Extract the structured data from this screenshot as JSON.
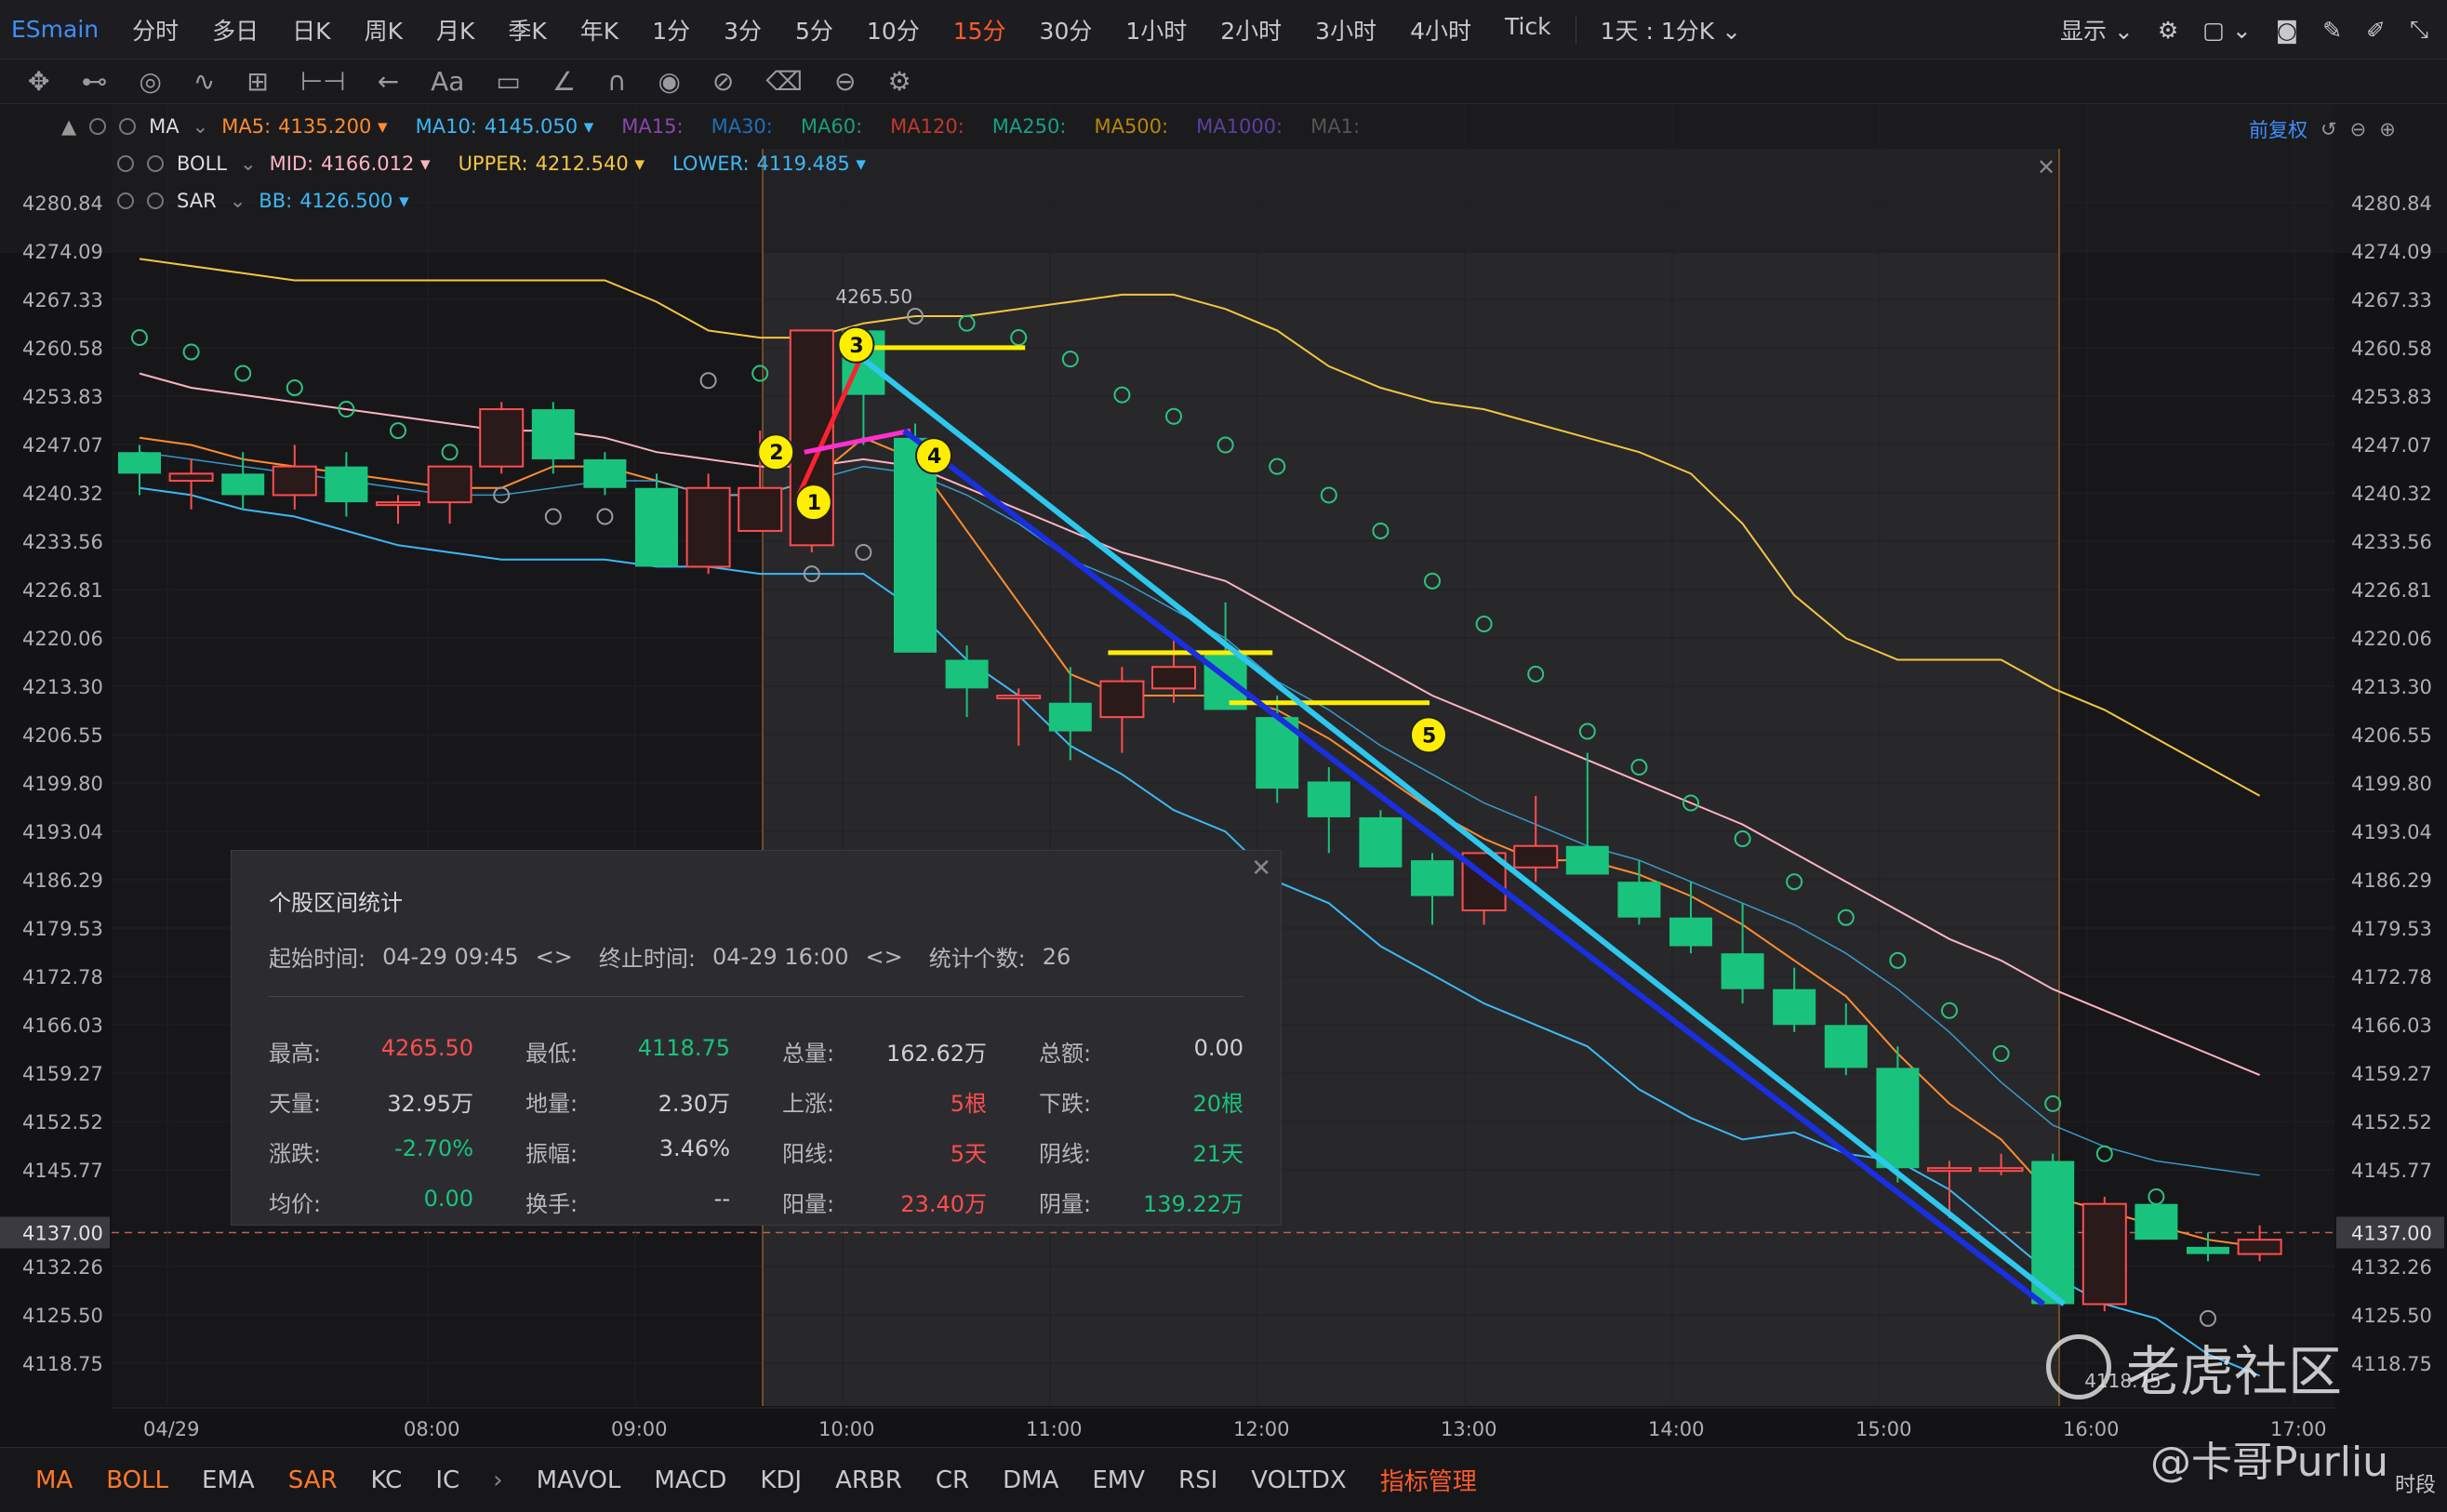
{
  "symbol": "ESmain",
  "periods": [
    "分时",
    "多日",
    "日K",
    "周K",
    "月K",
    "季K",
    "年K",
    "1分",
    "3分",
    "5分",
    "10分",
    "15分",
    "30分",
    "1小时",
    "2小时",
    "3小时",
    "4小时",
    "Tick"
  ],
  "active_period": "15分",
  "multi_chart": "1天 : 1分K",
  "display_label": "显示",
  "adjust_label": "前复权",
  "indicators": {
    "ma": {
      "name": "MA",
      "items": [
        {
          "label": "MA5:",
          "value": "4135.200",
          "color": "#ff8c2e"
        },
        {
          "label": "MA10:",
          "value": "4145.050",
          "color": "#3db8f5"
        },
        {
          "label": "MA15:",
          "value": "",
          "color": "#8e44ad"
        },
        {
          "label": "MA30:",
          "value": "",
          "color": "#1e6fb8"
        },
        {
          "label": "MA60:",
          "value": "",
          "color": "#1b9e77"
        },
        {
          "label": "MA120:",
          "value": "",
          "color": "#c0392b"
        },
        {
          "label": "MA250:",
          "value": "",
          "color": "#16a085"
        },
        {
          "label": "MA500:",
          "value": "",
          "color": "#b8860b"
        },
        {
          "label": "MA1000:",
          "value": "",
          "color": "#5b3fa0"
        },
        {
          "label": "MA1:",
          "value": "",
          "color": "#555555"
        }
      ]
    },
    "boll": {
      "name": "BOLL",
      "items": [
        {
          "label": "MID:",
          "value": "4166.012",
          "color": "#ffb3c1"
        },
        {
          "label": "UPPER:",
          "value": "4212.540",
          "color": "#f5c542"
        },
        {
          "label": "LOWER:",
          "value": "4119.485",
          "color": "#3db8f5"
        }
      ]
    },
    "sar": {
      "name": "SAR",
      "items": [
        {
          "label": "BB:",
          "value": "4126.500",
          "color": "#3db8f5"
        }
      ]
    }
  },
  "price_ticks": [
    "4280.84",
    "4274.09",
    "4267.33",
    "4260.58",
    "4253.83",
    "4247.07",
    "4240.32",
    "4233.56",
    "4226.81",
    "4220.06",
    "4213.30",
    "4206.55",
    "4199.80",
    "4193.04",
    "4186.29",
    "4179.53",
    "4172.78",
    "4166.03",
    "4159.27",
    "4152.52",
    "4145.77",
    "4132.26",
    "4125.50",
    "4118.75"
  ],
  "current_price": "4137.00",
  "time_ticks": [
    "04/29",
    "08:00",
    "09:00",
    "10:00",
    "11:00",
    "12:00",
    "13:00",
    "14:00",
    "15:00",
    "16:00",
    "17:00"
  ],
  "high_label": "4265.50",
  "low_label": "4118.75",
  "annotations": [
    "1",
    "2",
    "3",
    "4",
    "5"
  ],
  "stats": {
    "title": "个股区间统计",
    "start_label": "起始时间:",
    "start_value": "04-29 09:45",
    "end_label": "终止时间:",
    "end_value": "04-29 16:00",
    "count_label": "统计个数:",
    "count_value": "26",
    "rows": [
      [
        {
          "k": "最高:",
          "v": "4265.50",
          "c": "#ff4d4f"
        },
        {
          "k": "最低:",
          "v": "4118.75",
          "c": "#19c37d"
        },
        {
          "k": "总量:",
          "v": "162.62万",
          "c": "#d0d0d4"
        },
        {
          "k": "总额:",
          "v": "0.00",
          "c": "#d0d0d4"
        }
      ],
      [
        {
          "k": "天量:",
          "v": "32.95万",
          "c": "#d0d0d4"
        },
        {
          "k": "地量:",
          "v": "2.30万",
          "c": "#d0d0d4"
        },
        {
          "k": "上涨:",
          "v": "5根",
          "c": "#ff4d4f"
        },
        {
          "k": "下跌:",
          "v": "20根",
          "c": "#19c37d"
        }
      ],
      [
        {
          "k": "涨跌:",
          "v": "-2.70%",
          "c": "#19c37d"
        },
        {
          "k": "振幅:",
          "v": "3.46%",
          "c": "#d0d0d4"
        },
        {
          "k": "阳线:",
          "v": "5天",
          "c": "#ff4d4f"
        },
        {
          "k": "阴线:",
          "v": "21天",
          "c": "#19c37d"
        }
      ],
      [
        {
          "k": "均价:",
          "v": "0.00",
          "c": "#19c37d"
        },
        {
          "k": "换手:",
          "v": "--",
          "c": "#d0d0d4"
        },
        {
          "k": "阳量:",
          "v": "23.40万",
          "c": "#ff4d4f"
        },
        {
          "k": "阴量:",
          "v": "139.22万",
          "c": "#19c37d"
        }
      ]
    ]
  },
  "bottom_tabs": [
    {
      "label": "MA",
      "hl": true
    },
    {
      "label": "BOLL",
      "hl": true
    },
    {
      "label": "EMA",
      "hl": false
    },
    {
      "label": "SAR",
      "hl": true
    },
    {
      "label": "KC",
      "hl": false
    },
    {
      "label": "IC",
      "hl": false
    },
    {
      "label": "MAVOL",
      "hl": false
    },
    {
      "label": "MACD",
      "hl": false
    },
    {
      "label": "KDJ",
      "hl": false
    },
    {
      "label": "ARBR",
      "hl": false
    },
    {
      "label": "CR",
      "hl": false
    },
    {
      "label": "DMA",
      "hl": false
    },
    {
      "label": "EMV",
      "hl": false
    },
    {
      "label": "RSI",
      "hl": false
    },
    {
      "label": "VOLTDX",
      "hl": false
    }
  ],
  "manage_label": "指标管理",
  "footer_label": "时段",
  "watermark": {
    "brand": "老虎社区",
    "user": "@卡哥Purliu"
  },
  "colors": {
    "up": "#ff4d4f",
    "down": "#19c37d",
    "ma5": "#ff8c2e",
    "ma10": "#3db8f5",
    "boll_mid": "#ffb3c1",
    "boll_upper": "#f5c542"
  }
}
